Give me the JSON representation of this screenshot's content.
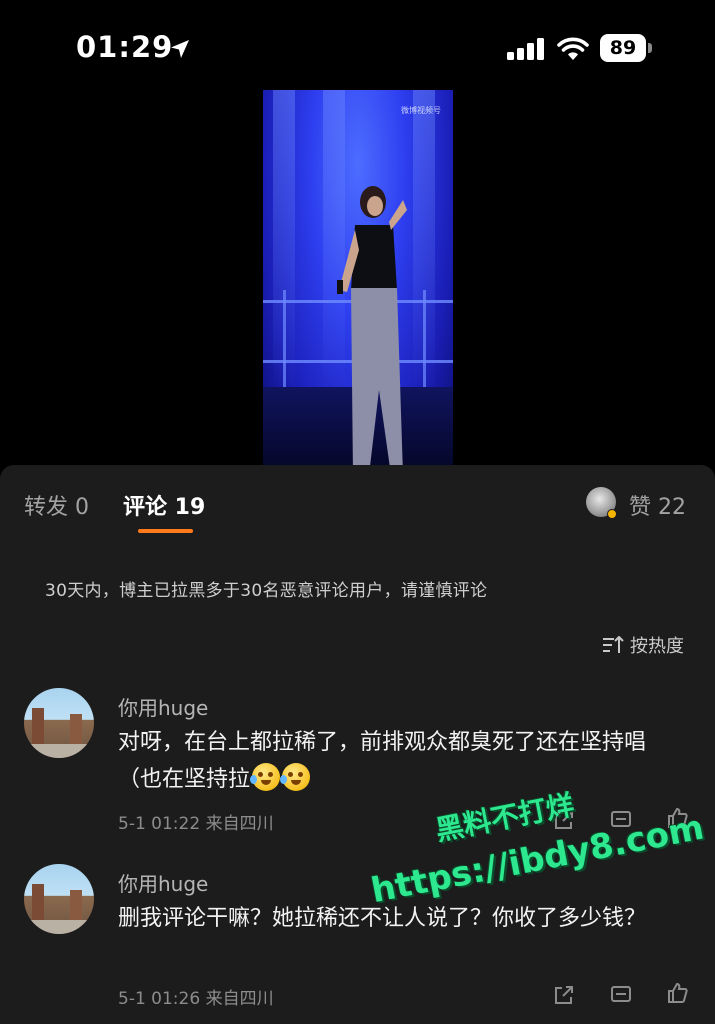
{
  "status_bar": {
    "time": "01:29",
    "battery": "89"
  },
  "video": {
    "watermark": "微博视频号"
  },
  "tabs": {
    "repost": "转发 0",
    "comments": "评论 19",
    "likes": "赞 22"
  },
  "notice": "30天内，博主已拉黑多于30名恶意评论用户，请谨慎评论",
  "sort_label": "按热度",
  "comments": [
    {
      "username": "你用huge",
      "text": "对呀，在台上都拉稀了，前排观众都臭死了还在坚持唱（也在坚持拉",
      "emojis": [
        "laugh-cry-emoji",
        "laugh-cry-emoji"
      ],
      "meta": "5-1 01:22  来自四川"
    },
    {
      "username": "你用huge",
      "text": "删我评论干嘛？她拉稀还不让人说了？你收了多少钱？",
      "meta": "5-1 01:26  来自四川"
    }
  ],
  "overlay_watermark": {
    "line1": "黑料不打烊",
    "line2": "https://ibdy8.com"
  },
  "colors": {
    "accent": "#ff7a1a",
    "panel_bg": "#1c1c1c",
    "watermark": "#2de88f"
  }
}
